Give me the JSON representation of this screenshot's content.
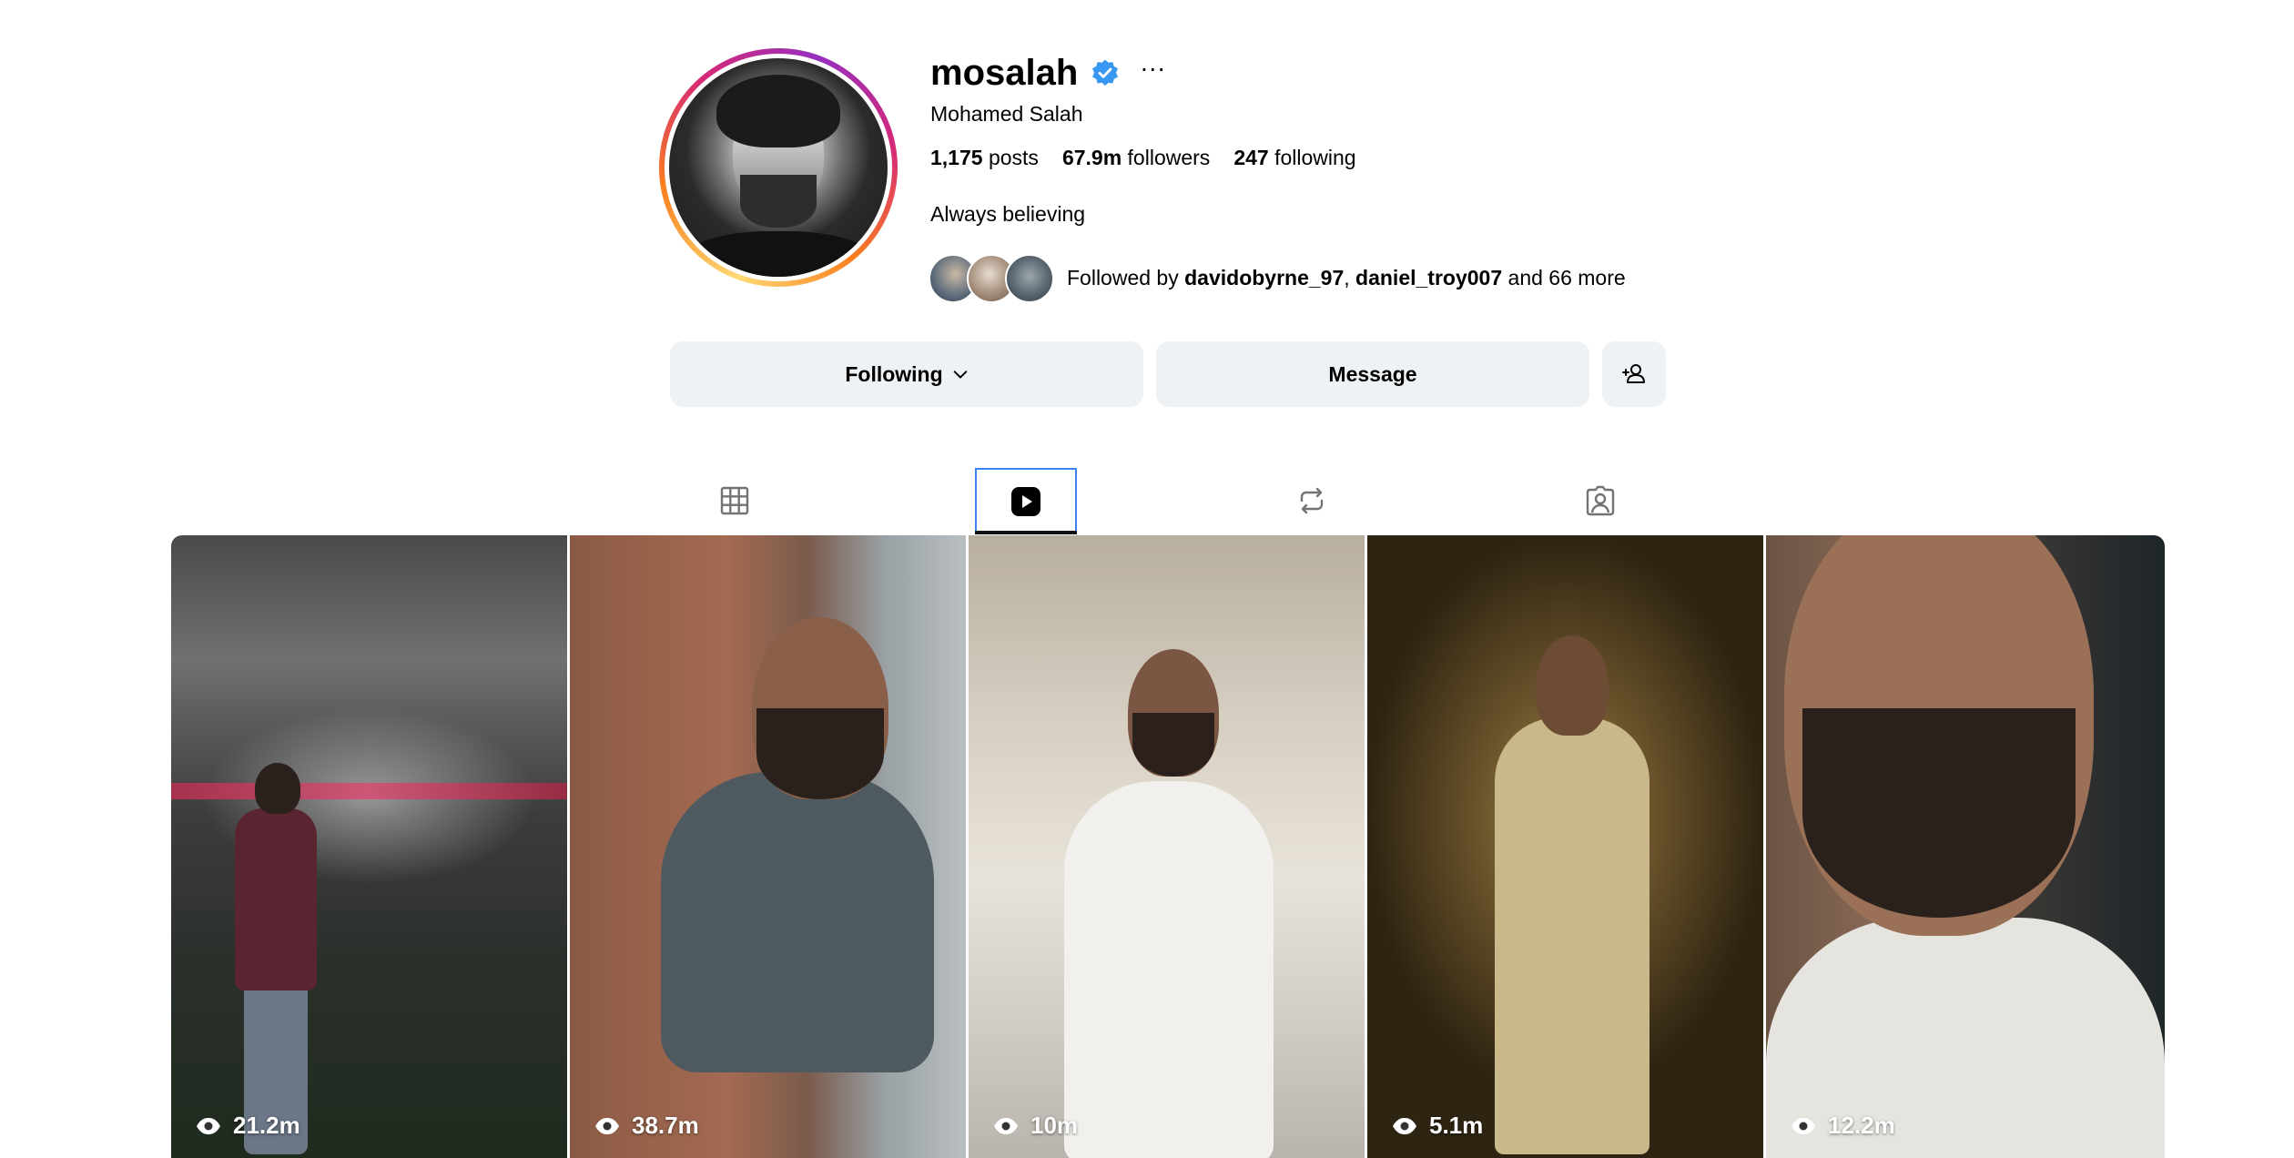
{
  "profile": {
    "username": "mosalah",
    "full_name": "Mohamed Salah",
    "stats": {
      "posts_count": "1,175",
      "posts_label": "posts",
      "followers_count": "67.9m",
      "followers_label": "followers",
      "following_count": "247",
      "following_label": "following"
    },
    "bio": "Always believing",
    "followed_by": {
      "prefix": "Followed by ",
      "user1": "davidobyrne_97",
      "separator": ", ",
      "user2": "daniel_troy007",
      "suffix": " and 66 more"
    }
  },
  "actions": {
    "following_label": "Following",
    "message_label": "Message"
  },
  "tabs": [
    {
      "icon": "grid-icon",
      "active": false
    },
    {
      "icon": "reels-icon",
      "active": true
    },
    {
      "icon": "reposts-icon",
      "active": false
    },
    {
      "icon": "tagged-icon",
      "active": false
    }
  ],
  "reels": [
    {
      "views": "21.2m"
    },
    {
      "views": "38.7m"
    },
    {
      "views": "10m"
    },
    {
      "views": "5.1m"
    },
    {
      "views": "12.2m"
    }
  ],
  "colors": {
    "verified_badge": "#3897f0",
    "button_bg": "#eff2f5",
    "active_tab_outline": "#3b82f6"
  }
}
